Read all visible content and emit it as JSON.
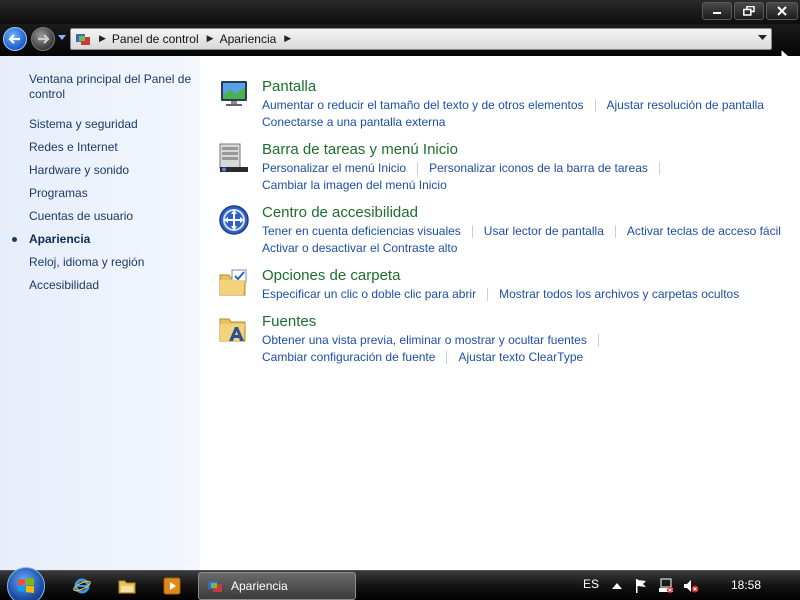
{
  "window": {
    "minimize_icon": "minimize-icon",
    "maximize_icon": "restore-icon",
    "close_icon": "close-icon"
  },
  "address": {
    "crumbs": [
      "Panel de control",
      "Apariencia"
    ]
  },
  "sidebar": {
    "items": [
      {
        "label": "Ventana principal del Panel de",
        "active": false
      },
      {
        "label": "control",
        "active": false
      },
      {
        "label": "Sistema y seguridad",
        "active": false
      },
      {
        "label": "Redes e Internet",
        "active": false
      },
      {
        "label": "Hardware y sonido",
        "active": false
      },
      {
        "label": "Programas",
        "active": false
      },
      {
        "label": "Cuentas de usuario",
        "active": false
      },
      {
        "label": "Apariencia",
        "active": true
      },
      {
        "label": "Reloj, idioma y región",
        "active": false
      },
      {
        "label": "Accesibilidad",
        "active": false
      }
    ]
  },
  "categories": [
    {
      "title": "Pantalla",
      "icon": "display-icon",
      "rows": [
        [
          "Aumentar o reducir el tamaño del texto y de otros elementos",
          "Ajustar resolución de pantalla"
        ],
        [
          "Conectarse a una pantalla externa"
        ]
      ]
    },
    {
      "title": "Barra de tareas y menú Inicio",
      "icon": "taskbar-icon",
      "rows": [
        [
          "Personalizar el menú Inicio",
          "Personalizar iconos de la barra de tareas"
        ],
        [
          "Cambiar la imagen del menú Inicio"
        ]
      ]
    },
    {
      "title": "Centro de accesibilidad",
      "icon": "accessibility-icon",
      "rows": [
        [
          "Tener en cuenta deficiencias visuales",
          "Usar lector de pantalla",
          "Activar teclas de acceso fácil"
        ],
        [
          "Activar o desactivar el Contraste alto"
        ]
      ]
    },
    {
      "title": "Opciones de carpeta",
      "icon": "folder-options-icon",
      "rows": [
        [
          "Especificar un clic o doble clic para abrir",
          "Mostrar todos los archivos y carpetas ocultos"
        ]
      ]
    },
    {
      "title": "Fuentes",
      "icon": "fonts-folder-icon",
      "rows": [
        [
          "Obtener una vista previa, eliminar o mostrar y ocultar fuentes"
        ],
        [
          "Cambiar configuración de fuente",
          "Ajustar texto ClearType"
        ]
      ]
    }
  ],
  "taskbar": {
    "window_label": "Apariencia",
    "language": "ES",
    "clock": "18:58"
  },
  "colors": {
    "link": "#1c4fa8",
    "category_title": "#1e6e2c",
    "sidebar_text": "#1c3a68"
  }
}
